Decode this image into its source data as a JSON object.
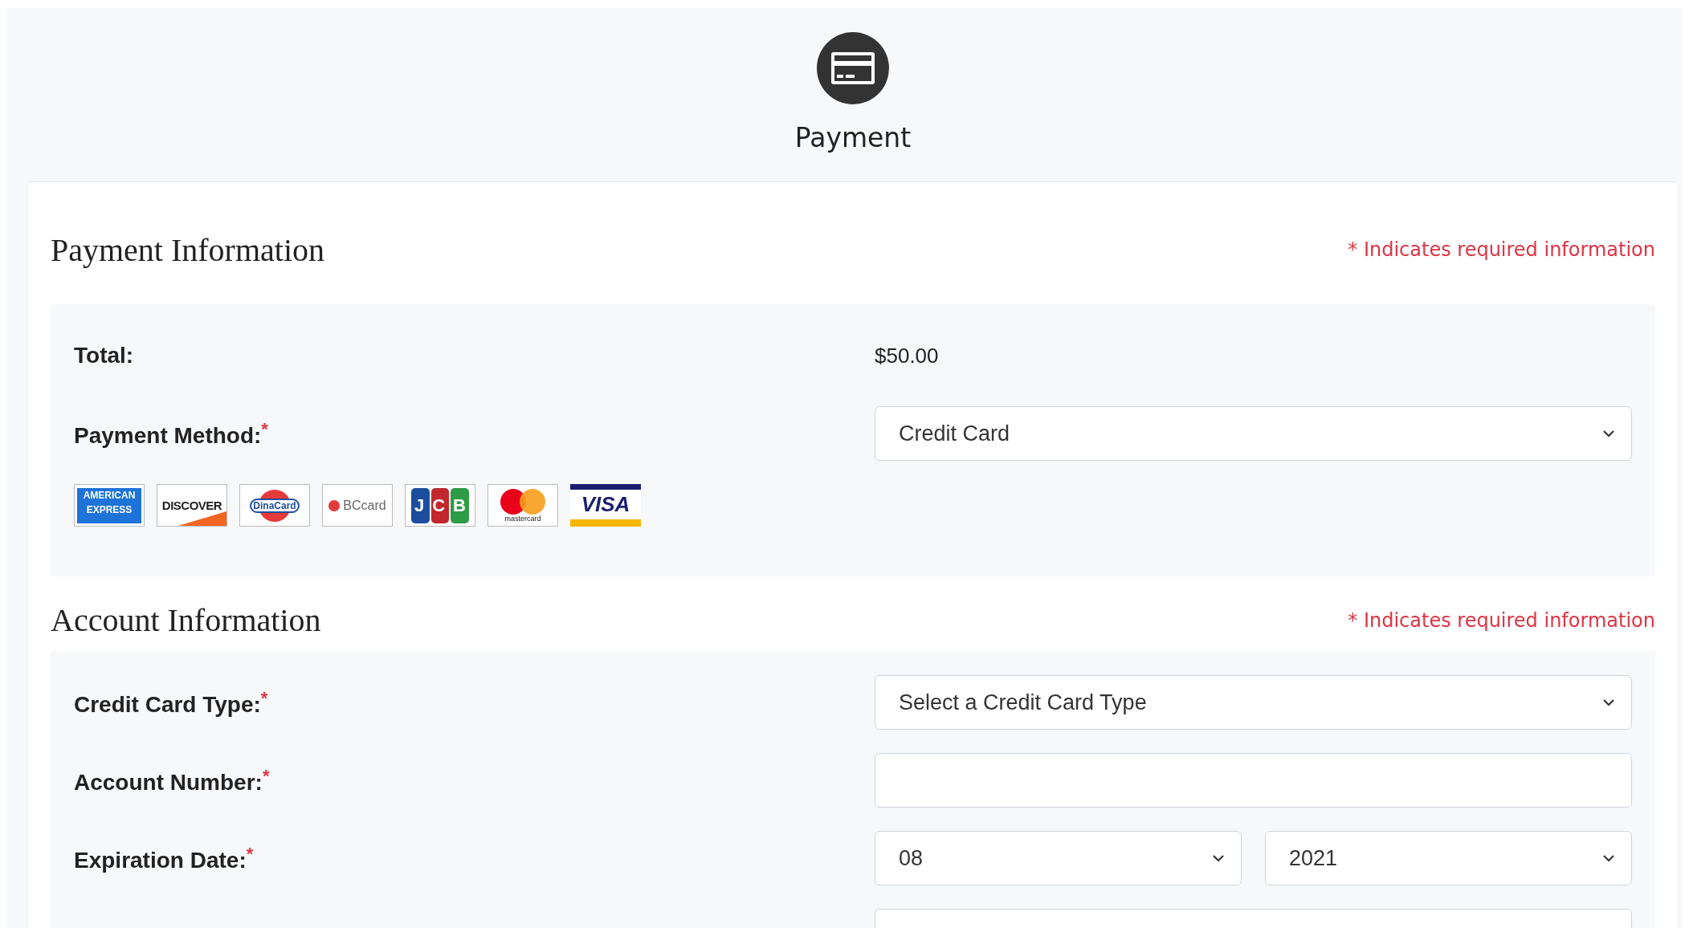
{
  "header": {
    "title": "Payment"
  },
  "sections": [
    {
      "title": "Payment Information",
      "required_note": "* Indicates required information",
      "rows": [
        {
          "kind": "static",
          "label": "Total:",
          "value": "$50.00"
        },
        {
          "kind": "select",
          "label": "Payment Method:",
          "required_mark": "*",
          "value": "Credit Card"
        }
      ],
      "card_logos": [
        {
          "kind": "amex",
          "text": "AMERICAN EXPRESS"
        },
        {
          "kind": "discover",
          "text": "DISCOVER"
        },
        {
          "kind": "dinacard",
          "text": "DinaCard"
        },
        {
          "kind": "bccard",
          "text": "BCcard"
        },
        {
          "kind": "jcb",
          "text": "JCB"
        },
        {
          "kind": "mastercard",
          "text": "mastercard"
        },
        {
          "kind": "visa",
          "text": "VISA"
        }
      ]
    },
    {
      "title": "Account Information",
      "required_note": "* Indicates required information",
      "rows": [
        {
          "kind": "select",
          "label": "Credit Card Type:",
          "required_mark": "*",
          "value": "Select a Credit Card Type"
        },
        {
          "kind": "text",
          "label": "Account Number:",
          "required_mark": "*"
        },
        {
          "kind": "date",
          "label": "Expiration Date:",
          "required_mark": "*",
          "month": "08",
          "year": "2021"
        },
        {
          "kind": "text"
        }
      ]
    }
  ]
}
